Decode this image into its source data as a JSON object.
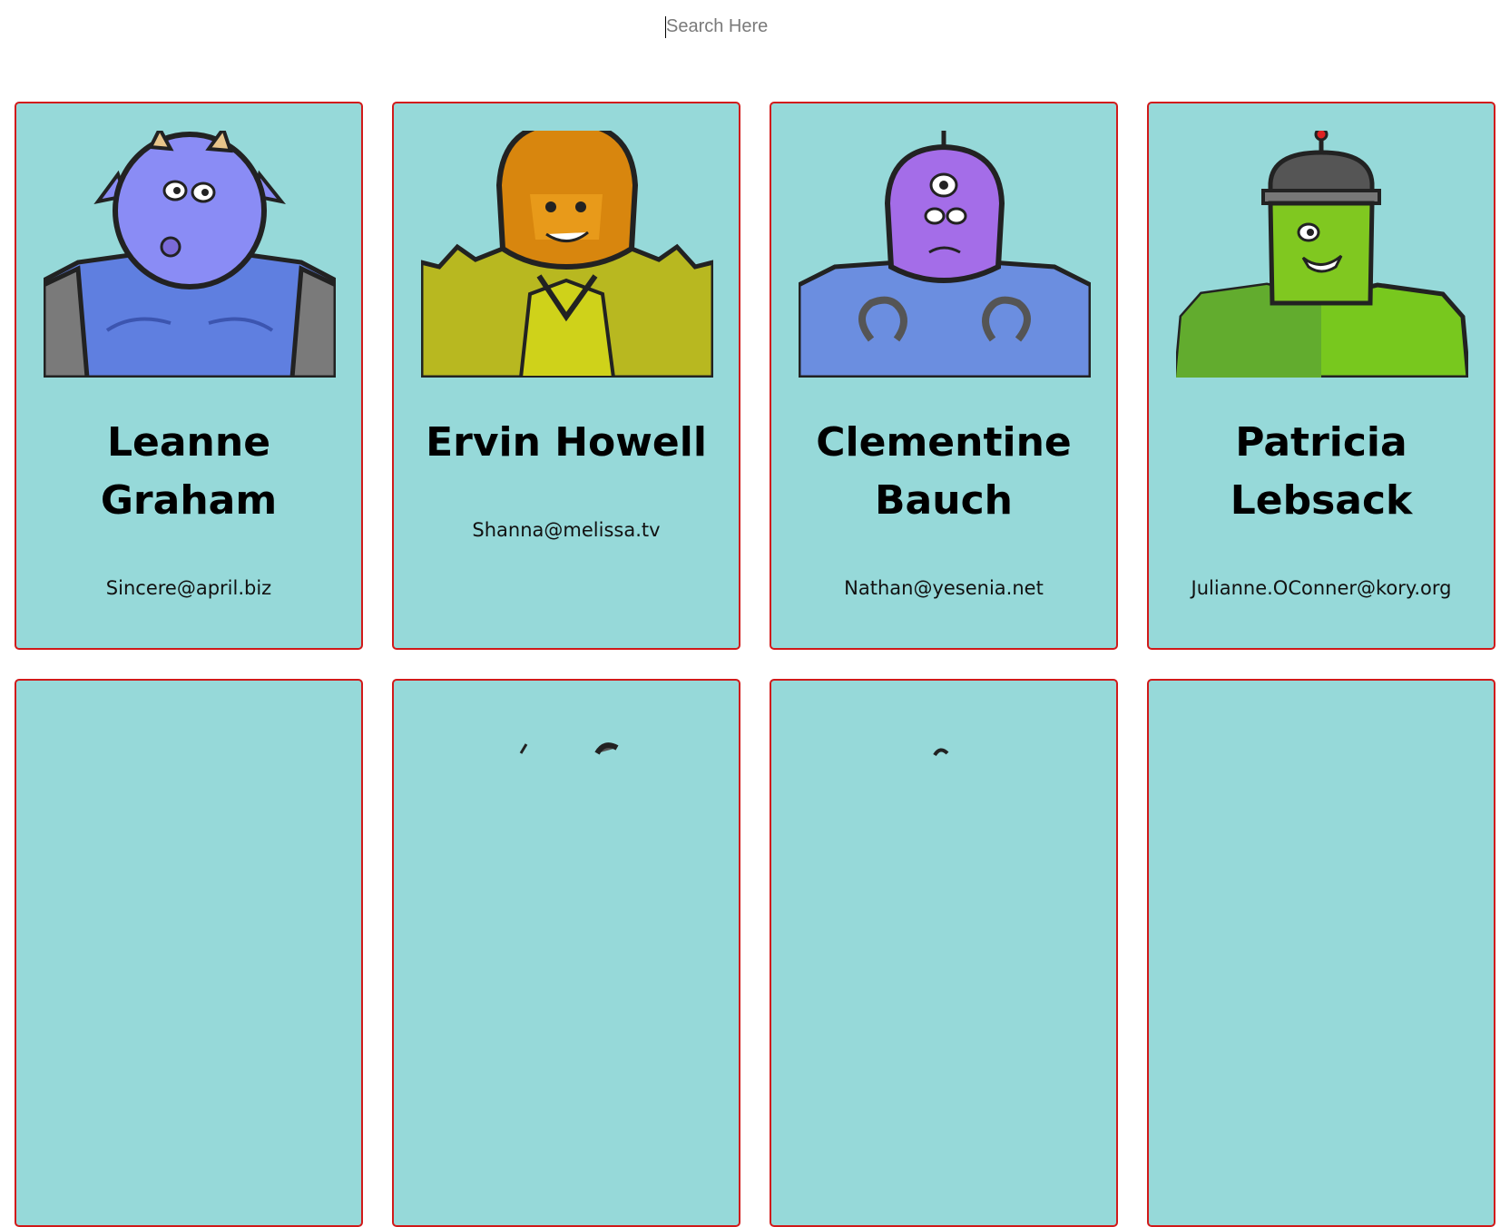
{
  "search": {
    "placeholder": "Search Here",
    "value": ""
  },
  "cards": [
    {
      "name": "Leanne Graham",
      "email": "Sincere@april.biz",
      "avatar_icon": "blue-horned-monster-robot-icon",
      "avatar_color": "#8a8cf5"
    },
    {
      "name": "Ervin Howell",
      "email": "Shanna@melissa.tv",
      "avatar_icon": "orange-helmet-spiky-robot-icon",
      "avatar_color": "#e08a12"
    },
    {
      "name": "Clementine Bauch",
      "email": "Nathan@yesenia.net",
      "avatar_icon": "purple-cyclops-alien-robot-icon",
      "avatar_color": "#a46de8"
    },
    {
      "name": "Patricia Lebsack",
      "email": "Julianne.OConner@kory.org",
      "avatar_icon": "green-frankenstein-robot-icon",
      "avatar_color": "#78c81e"
    }
  ],
  "colors": {
    "card_background": "#96d9d9",
    "card_border": "#d11a1a"
  }
}
